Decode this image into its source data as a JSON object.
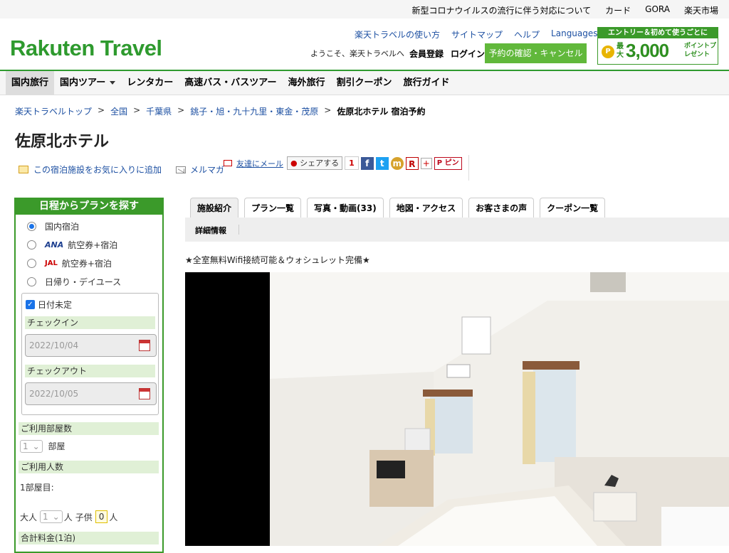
{
  "topbar": {
    "links": [
      "新型コロナウイルスの流行に伴う対応について",
      "カード",
      "GORA",
      "楽天市場"
    ]
  },
  "header": {
    "logo": "Rakuten Travel",
    "help_links": [
      "楽天トラベルの使い方",
      "サイトマップ",
      "ヘルプ"
    ],
    "languages": "Languages",
    "welcome": "ようこそ、楽天トラベルへ",
    "register": "会員登録",
    "login": "ログイン",
    "reserve_button": "予約の確認・キャンセル",
    "banner": {
      "head": "エントリー＆初めて使うごとに",
      "coin": "P",
      "max": "最大",
      "amount": "3,000",
      "points": "ポイントプレゼント"
    }
  },
  "nav": {
    "items": [
      "国内旅行",
      "国内ツアー",
      "レンタカー",
      "高速バス・バスツアー",
      "海外旅行",
      "割引クーポン",
      "旅行ガイド"
    ],
    "active_index": 0
  },
  "breadcrumb": {
    "links": [
      "楽天トラベルトップ",
      "全国",
      "千葉県",
      "銚子・旭・九十九里・東金・茂原"
    ],
    "separator": ">",
    "current": "佐原北ホテル 宿泊予約"
  },
  "hotel": {
    "name": "佐原北ホテル",
    "favorite": "この宿泊施設をお気に入りに追加",
    "mailmag": "メルマガ"
  },
  "social": {
    "mail_friend": "友達にメール",
    "share": "シェアする",
    "share_count": "1",
    "pin": "ピン"
  },
  "search": {
    "title": "日程からプランを探す",
    "types": [
      {
        "logo": "",
        "label": "国内宿泊"
      },
      {
        "logo": "ANA",
        "label": "航空券+宿泊"
      },
      {
        "logo": "JAL",
        "label": "航空券+宿泊"
      },
      {
        "logo": "",
        "label": "日帰り・デイユース"
      }
    ],
    "selected_type_index": 0,
    "undecided": "日付未定",
    "checkin_label": "チェックイン",
    "checkin": "2022/10/04",
    "checkout_label": "チェックアウト",
    "checkout": "2022/10/05",
    "rooms_label": "ご利用部屋数",
    "rooms": "1",
    "rooms_unit": "部屋",
    "people_label": "ご利用人数",
    "room1": "1部屋目:",
    "adult_label": "大人",
    "adults": "1",
    "adult_unit": "人",
    "child_label": "子供",
    "children": "0",
    "child_unit": "人",
    "total_label": "合計料金(1泊)"
  },
  "tabs": {
    "items": [
      "施設紹介",
      "プラン一覧",
      "写真・動画(33)",
      "地図・アクセス",
      "お客さまの声",
      "クーポン一覧"
    ],
    "active_index": 0,
    "sub": "詳細情報"
  },
  "catch": "★全室無料Wifi接続可能＆ウォシュレット完備★",
  "colors": {
    "green": "#3b9a2a",
    "link": "#1d50a2",
    "button_green": "#61b83b"
  }
}
